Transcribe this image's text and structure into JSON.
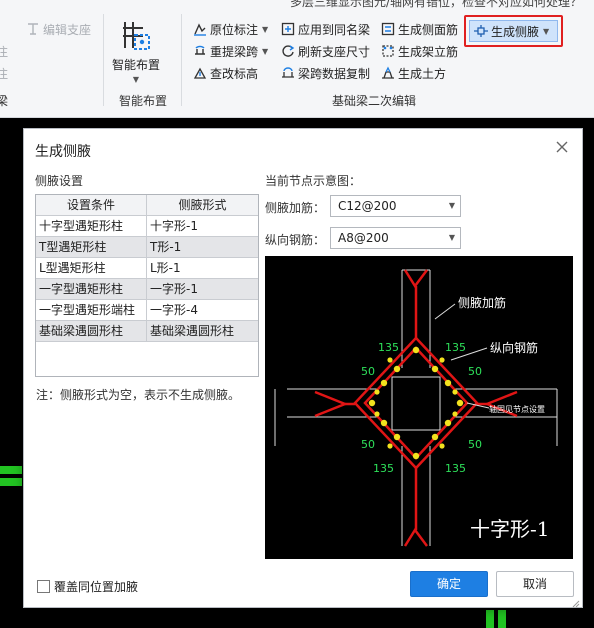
{
  "top_fragment": "多层三维显示图元/轴网有错位，检查不对应如何处理？",
  "ribbon": {
    "left_partial": {
      "edit_support": "编辑支座",
      "cut1": "注",
      "cut2": "注",
      "group_label": "梁"
    },
    "smart_layout": {
      "label": "智能布置",
      "group_label": "智能布置"
    },
    "col1": [
      {
        "label": "原位标注",
        "has_dropdown": true,
        "icon": "inplace-annotation-icon"
      },
      {
        "label": "重提梁跨",
        "has_dropdown": true,
        "icon": "re-extract-span-icon"
      },
      {
        "label": "查改标高",
        "has_dropdown": false,
        "icon": "edit-elevation-icon"
      }
    ],
    "col2": [
      {
        "label": "应用到同名梁",
        "icon": "apply-same-name-icon"
      },
      {
        "label": "刷新支座尺寸",
        "icon": "refresh-support-icon"
      },
      {
        "label": "梁跨数据复制",
        "icon": "copy-span-data-icon"
      }
    ],
    "col3": [
      {
        "label": "生成侧面筋",
        "icon": "side-rebar-icon"
      },
      {
        "label": "生成架立筋",
        "icon": "erection-rebar-icon"
      },
      {
        "label": "生成土方",
        "icon": "earthwork-icon"
      }
    ],
    "highlight_button": {
      "label": "生成侧腋",
      "icon": "haunch-icon"
    },
    "group_label": "基础梁二次编辑"
  },
  "dialog": {
    "title": "生成侧腋",
    "left_section": "侧腋设置",
    "table": {
      "headers": [
        "设置条件",
        "侧腋形式"
      ],
      "rows": [
        [
          "十字型遇矩形柱",
          "十字形-1"
        ],
        [
          "T型遇矩形柱",
          "T形-1"
        ],
        [
          "L型遇矩形柱",
          "L形-1"
        ],
        [
          "一字型遇矩形柱",
          "一字形-1"
        ],
        [
          "一字型遇矩形端柱",
          "一字形-4"
        ],
        [
          "基础梁遇圆形柱",
          "基础梁遇圆形柱"
        ]
      ]
    },
    "note": "注：侧腋形式为空，表示不生成侧腋。",
    "right_section": "当前节点示意图：",
    "haunch_rebar_label": "侧腋加筋：",
    "haunch_rebar_value": "C12@200",
    "long_rebar_label": "纵向钢筋：",
    "long_rebar_value": "A8@200",
    "diagram": {
      "label_haunch": "侧腋加筋",
      "label_long": "纵向钢筋",
      "label_side": "轴固见节点设置",
      "dim_135": "135",
      "dim_50": "50",
      "caption": "十字形-1"
    },
    "checkbox_label": "覆盖同位置加腋",
    "ok_label": "确定",
    "cancel_label": "取消"
  }
}
